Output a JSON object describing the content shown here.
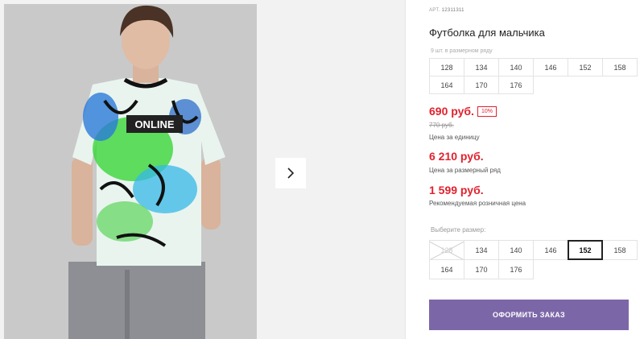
{
  "product": {
    "sku_label": "АРТ.",
    "sku": "12311311",
    "title": "Футболка для мальчика",
    "row_count": "9 шт. в размерном ряду",
    "row_sizes": [
      "128",
      "134",
      "140",
      "146",
      "152",
      "158",
      "164",
      "170",
      "176"
    ],
    "price": "690 руб.",
    "discount": "10%",
    "old_price": "770 руб.",
    "price_note": "Цена за единицу",
    "row_price": "6 210 руб.",
    "row_price_note": "Цена за размерный ряд",
    "retail_price": "1 599 руб.",
    "retail_price_note": "Рекомендуемая розничная цена",
    "choose_label": "Выберите размер:",
    "sizes": [
      {
        "label": "128",
        "state": "disabled"
      },
      {
        "label": "134",
        "state": "normal"
      },
      {
        "label": "140",
        "state": "normal"
      },
      {
        "label": "146",
        "state": "normal"
      },
      {
        "label": "152",
        "state": "selected"
      },
      {
        "label": "158",
        "state": "normal"
      },
      {
        "label": "164",
        "state": "normal"
      },
      {
        "label": "170",
        "state": "normal"
      },
      {
        "label": "176",
        "state": "normal"
      }
    ],
    "order_button": "ОФОРМИТЬ ЗАКАЗ",
    "shirt_print": "ONLINE"
  },
  "gallery": {
    "next_icon": "chevron-right-icon"
  },
  "colors": {
    "accent": "#7b67a8",
    "price": "#e1222e"
  }
}
